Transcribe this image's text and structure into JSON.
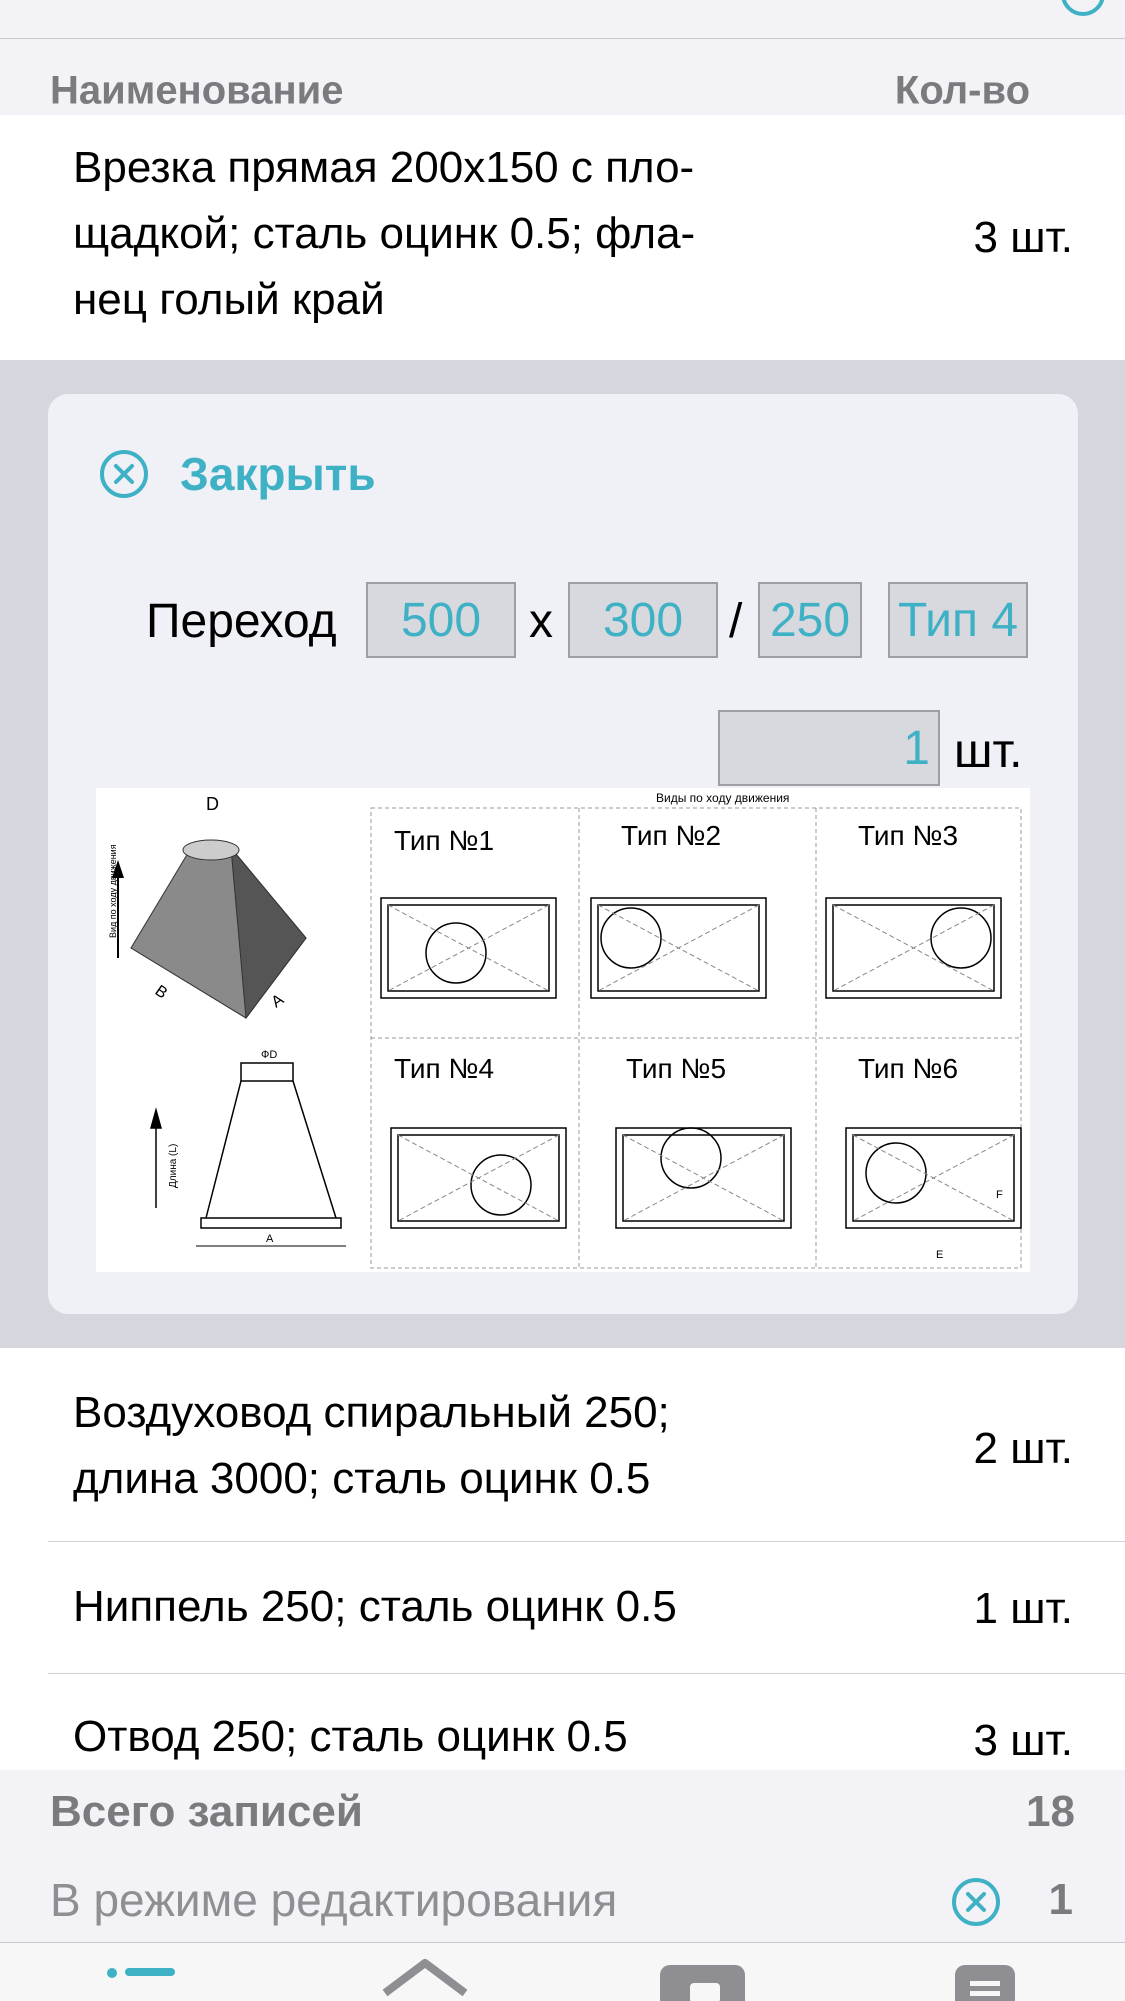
{
  "header": {
    "col_name": "Наименование",
    "col_qty": "Кол-во"
  },
  "items": [
    {
      "name_lines": [
        "Врезка прямая 200x150 с пло-",
        "щадкой; сталь оцинк 0.5; фла-",
        "нец голый край"
      ],
      "qty": "3 шт."
    },
    {
      "name_lines": [
        "Воздуховод спиральный 250;",
        "длина 3000; сталь оцинк 0.5"
      ],
      "qty": "2 шт."
    },
    {
      "name_lines": [
        "Ниппель 250; сталь оцинк 0.5"
      ],
      "qty": "1 шт."
    },
    {
      "name_lines": [
        "Отвод 250; сталь оцинк 0.5"
      ],
      "qty": "3 шт."
    }
  ],
  "editor": {
    "close_label": "Закрыть",
    "item_type": "Переход",
    "width": "500",
    "height": "300",
    "diameter": "250",
    "variant": "Тип 4",
    "times_sign": "x",
    "slash": "/",
    "quantity": "1",
    "quantity_unit": "шт.",
    "info_label": "i",
    "diagram": {
      "heading": "Виды по ходу движения",
      "types": [
        "Тип №1",
        "Тип №2",
        "Тип №3",
        "Тип №4",
        "Тип №5",
        "Тип №6"
      ],
      "dim_a": "A",
      "dim_b": "B",
      "dim_d": "D",
      "dim_phi_d": "ФD",
      "dim_e": "E",
      "dim_f": "F",
      "flow_label": "Вид по ходу движения",
      "length_label": "Длина (L)"
    }
  },
  "footer": {
    "total_label": "Всего записей",
    "total_value": "18",
    "edit_label": "В режиме редактирования",
    "edit_value": "1"
  },
  "colors": {
    "accent": "#3fb1c5",
    "edit_bg": "#d6d6de",
    "card_bg": "#f0f0f7"
  },
  "tabbar": {
    "icons": [
      "list-icon",
      "home-icon",
      "wallet-icon",
      "document-icon"
    ]
  }
}
